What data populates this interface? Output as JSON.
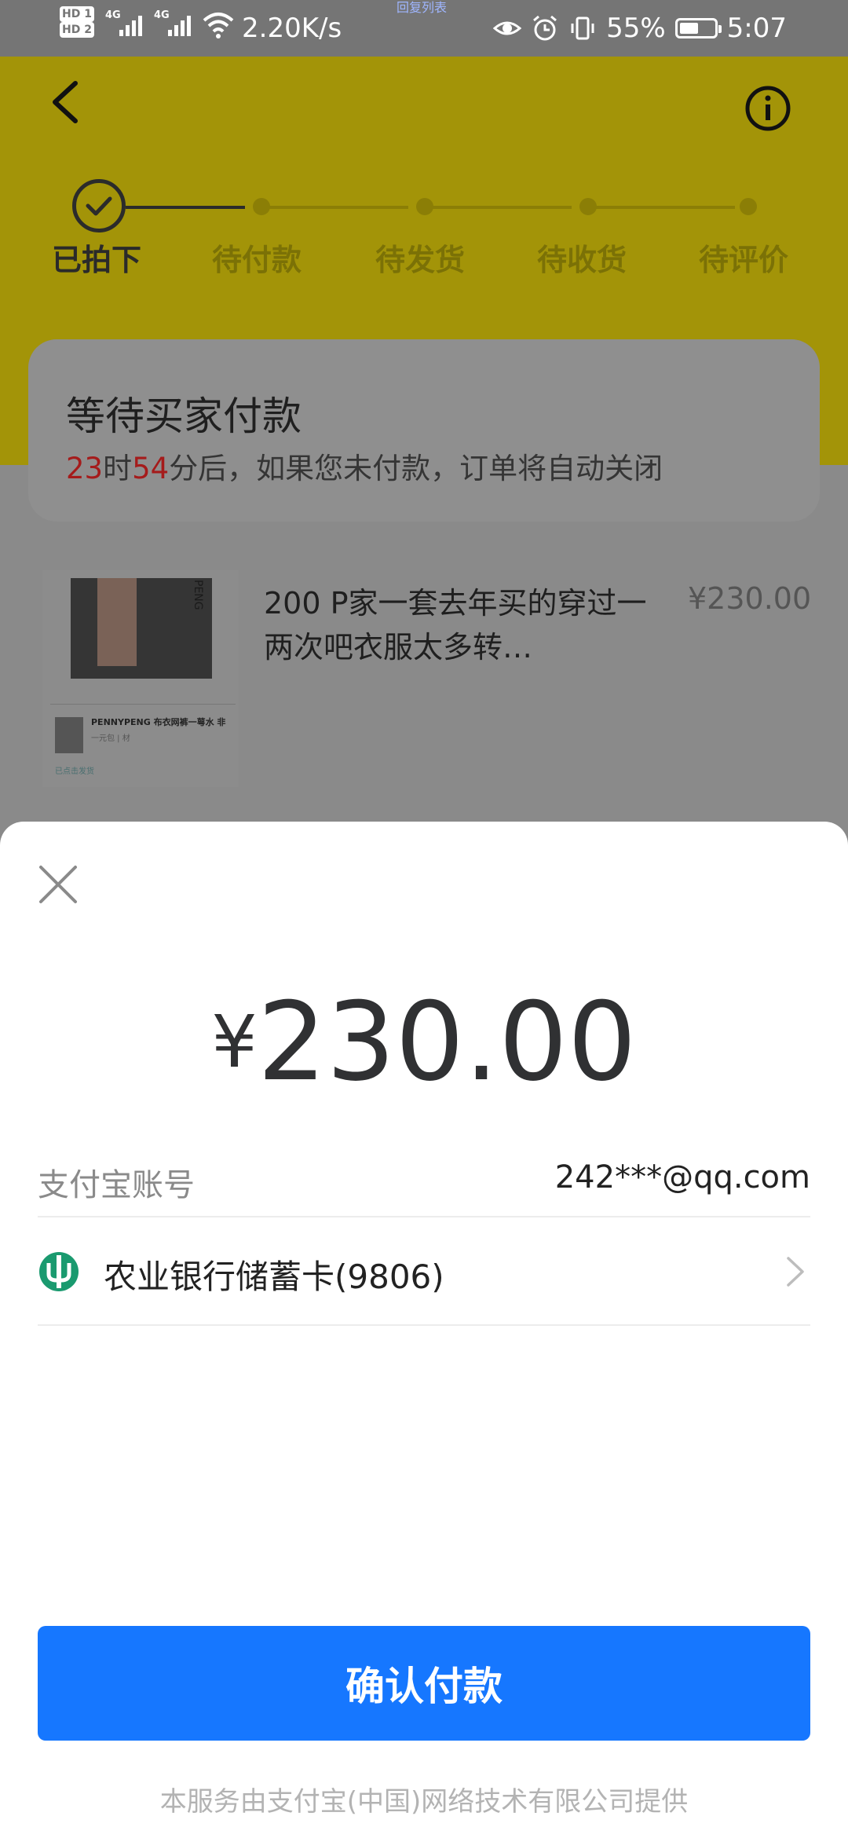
{
  "status_bar": {
    "hd1": "HD 1",
    "hd2": "HD 2",
    "sig1": "4G",
    "sig2": "4G",
    "speed": "2.20K/s",
    "tiny_label": "回复列表",
    "battery": "55%",
    "battery_level": 0.55,
    "time": "5:07"
  },
  "header": {
    "icons": {
      "back": "back-arrow-icon",
      "info": "info-icon"
    }
  },
  "progress": {
    "steps": [
      "已拍下",
      "待付款",
      "待发货",
      "待收货",
      "待评价"
    ],
    "current_index": 0,
    "colors": {
      "active": "#2b2b2b",
      "inactive": "#8b7e06",
      "hero_bg": "#a39408"
    }
  },
  "status_card": {
    "title": "等待买家付款",
    "hours": "23",
    "hours_unit": "时",
    "minutes": "54",
    "rest": "分后，如果您未付款，订单将自动关闭"
  },
  "item": {
    "title": "200 P家一套去年买的穿过一两次吧衣服太多转…",
    "price": "¥230.00",
    "thumb": {
      "side_tag": "PENG",
      "mini_title": "PENNYPENG 布衣网裤一萼水 非",
      "mini_sub": "一元包 | 材",
      "mini_foot": "已点击发货"
    }
  },
  "payment_sheet": {
    "currency": "¥",
    "amount": "230.00",
    "account_label": "支付宝账号",
    "account_value": "242***@qq.com",
    "card_label": "农业银行储蓄卡(9806)",
    "confirm_label": "确认付款",
    "footer": "本服务由支付宝(中国)网络技术有限公司提供",
    "colors": {
      "button": "#1677ff",
      "bank": "#1a9a6f"
    }
  }
}
